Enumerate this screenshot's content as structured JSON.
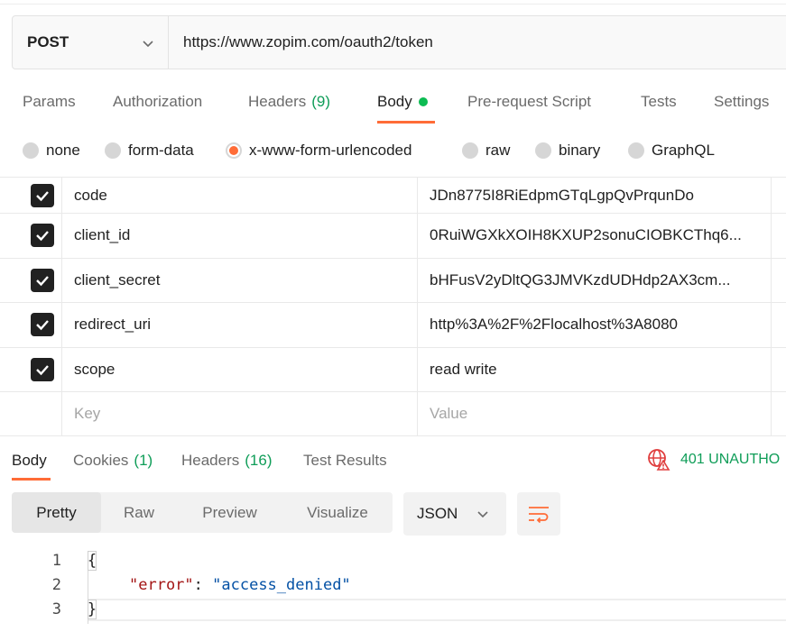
{
  "request": {
    "method": "POST",
    "url": "https://www.zopim.com/oauth2/token"
  },
  "request_tabs": [
    {
      "label": "Params"
    },
    {
      "label": "Authorization"
    },
    {
      "label": "Headers",
      "count": "(9)"
    },
    {
      "label": "Body"
    },
    {
      "label": "Pre-request Script"
    },
    {
      "label": "Tests"
    },
    {
      "label": "Settings"
    }
  ],
  "body_types": [
    "none",
    "form-data",
    "x-www-form-urlencoded",
    "raw",
    "binary",
    "GraphQL"
  ],
  "params": [
    {
      "key": "code",
      "value": "JDn8775I8RiEdpmGTqLgpQvPrqunDo"
    },
    {
      "key": "client_id",
      "value": "0RuiWGXkXOIH8KXUP2sonuCIOBKCThq6..."
    },
    {
      "key": "client_secret",
      "value": "bHFusV2yDltQG3JMVKzdUDHdp2AX3cm..."
    },
    {
      "key": "redirect_uri",
      "value": "http%3A%2F%2Flocalhost%3A8080"
    },
    {
      "key": "scope",
      "value": "read write"
    }
  ],
  "new_param": {
    "key_placeholder": "Key",
    "value_placeholder": "Value"
  },
  "response_tabs": [
    {
      "label": "Body"
    },
    {
      "label": "Cookies",
      "count": "(1)"
    },
    {
      "label": "Headers",
      "count": "(16)"
    },
    {
      "label": "Test Results"
    }
  ],
  "status": "401 UNAUTHO",
  "view_modes": [
    "Pretty",
    "Raw",
    "Preview",
    "Visualize"
  ],
  "format": "JSON",
  "code": {
    "line_numbers": [
      "1",
      "2",
      "3"
    ],
    "open": "{",
    "close": "}",
    "key": "\"error\"",
    "colon": ": ",
    "value": "\"access_denied\""
  },
  "colors": {
    "accent": "#ff6c37",
    "success": "#0f9d58",
    "error_icon": "#e03e3e"
  }
}
